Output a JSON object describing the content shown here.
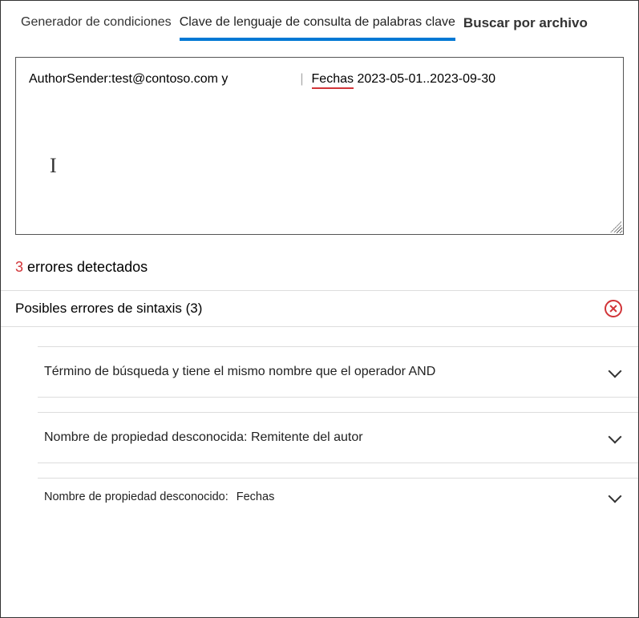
{
  "tabs": {
    "builder": "Generador de condiciones",
    "kql": "Clave de lenguaje de consulta de palabras clave",
    "byfile": "Buscar por archivo"
  },
  "query": {
    "seg_prop_author": "AuthorSender",
    "seg_colon_value": ":test@contoso.com ",
    "seg_and_op": "y",
    "seg_sep": "|",
    "seg_prop_dates": "Fechas",
    "seg_dates_value": " 2023-05-01..2023-09-30"
  },
  "status": {
    "count": "3",
    "label": " errores detectados"
  },
  "section": {
    "title_pre": "Posibles errores de sintaxis (",
    "count": "3",
    "title_post": ")"
  },
  "issues": {
    "i1": "Término de búsqueda y tiene el mismo nombre que el operador AND",
    "i2": "Nombre de propiedad desconocida: Remitente del autor",
    "i3_label": "Nombre de propiedad desconocido:",
    "i3_prop": "Fechas"
  }
}
